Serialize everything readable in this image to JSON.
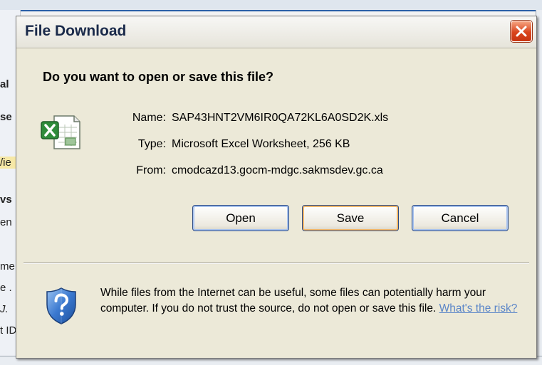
{
  "background": {
    "left_fragments": [
      "al",
      "se",
      "/ie",
      "vs",
      "en",
      "me",
      "e .",
      "J.",
      "t ID"
    ]
  },
  "dialog": {
    "title": "File Download",
    "question": "Do you want to open or save this file?",
    "file_icon": "excel-file-icon",
    "fields": [
      {
        "label": "Name:",
        "value": "SAP43HNT2VM6IR0QA72KL6A0SD2K.xls"
      },
      {
        "label": "Type:",
        "value": "Microsoft Excel Worksheet, 256 KB"
      },
      {
        "label": "From:",
        "value": "cmodcazd13.gocm-mdgc.sakmsdev.gc.ca"
      }
    ],
    "buttons": {
      "open": "Open",
      "save": "Save",
      "cancel": "Cancel"
    },
    "warning_text": "While files from the Internet can be useful, some files can potentially harm your computer. If you do not trust the source, do not open or save this file.",
    "risk_link": "What's the risk?",
    "warning_icon": "shield-question-icon",
    "close_icon": "close-icon"
  },
  "colors": {
    "dialog_bg": "#ece9d8",
    "close_button": "#d9441c",
    "link": "#5b86c8"
  }
}
